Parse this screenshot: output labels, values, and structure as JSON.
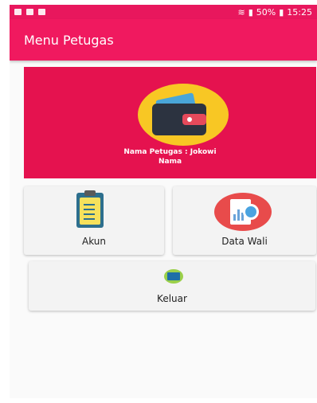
{
  "statusbar": {
    "signal": "\u0019 .\u0019",
    "battery": "50%",
    "time": "15:25"
  },
  "appbar": {
    "title": "Menu Petugas"
  },
  "profile": {
    "line1": "Nama Petugas   : Jokowi",
    "line2": "Nama"
  },
  "menu": {
    "akun": "Akun",
    "data_wali": "Data Wali",
    "keluar": "Keluar"
  },
  "colors": {
    "primary": "#f0195f",
    "profile_bg": "#e5124f",
    "wallet_circle": "#f8c724"
  },
  "icons": [
    "wallet-icon",
    "clipboard-icon",
    "chart-icon",
    "monitor-icon"
  ]
}
